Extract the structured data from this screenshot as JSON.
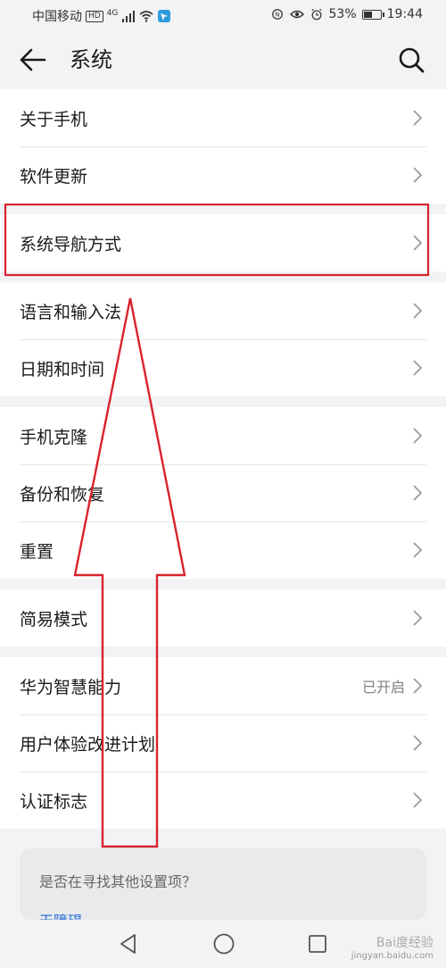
{
  "status_bar": {
    "carrier": "中国移动",
    "hd": "HD",
    "network": "4G",
    "battery": "53%",
    "battery_level": 0.53,
    "time": "19:44"
  },
  "header": {
    "title": "系统"
  },
  "groups": [
    {
      "items": [
        {
          "label": "关于手机"
        },
        {
          "label": "软件更新"
        }
      ]
    },
    {
      "items": [
        {
          "label": "系统导航方式"
        }
      ]
    },
    {
      "items": [
        {
          "label": "语言和输入法"
        },
        {
          "label": "日期和时间"
        }
      ]
    },
    {
      "items": [
        {
          "label": "手机克隆"
        },
        {
          "label": "备份和恢复"
        },
        {
          "label": "重置"
        }
      ]
    },
    {
      "items": [
        {
          "label": "简易模式"
        }
      ]
    },
    {
      "items": [
        {
          "label": "华为智慧能力",
          "status": "已开启"
        },
        {
          "label": "用户体验改进计划"
        },
        {
          "label": "认证标志"
        }
      ]
    }
  ],
  "search_card": {
    "question": "是否在寻找其他设置项？",
    "link": "无障碍"
  },
  "watermark": {
    "brand": "Bai度经验",
    "url": "jingyan.baidu.com"
  },
  "annotation": {
    "highlight_color": "#d9232d"
  }
}
